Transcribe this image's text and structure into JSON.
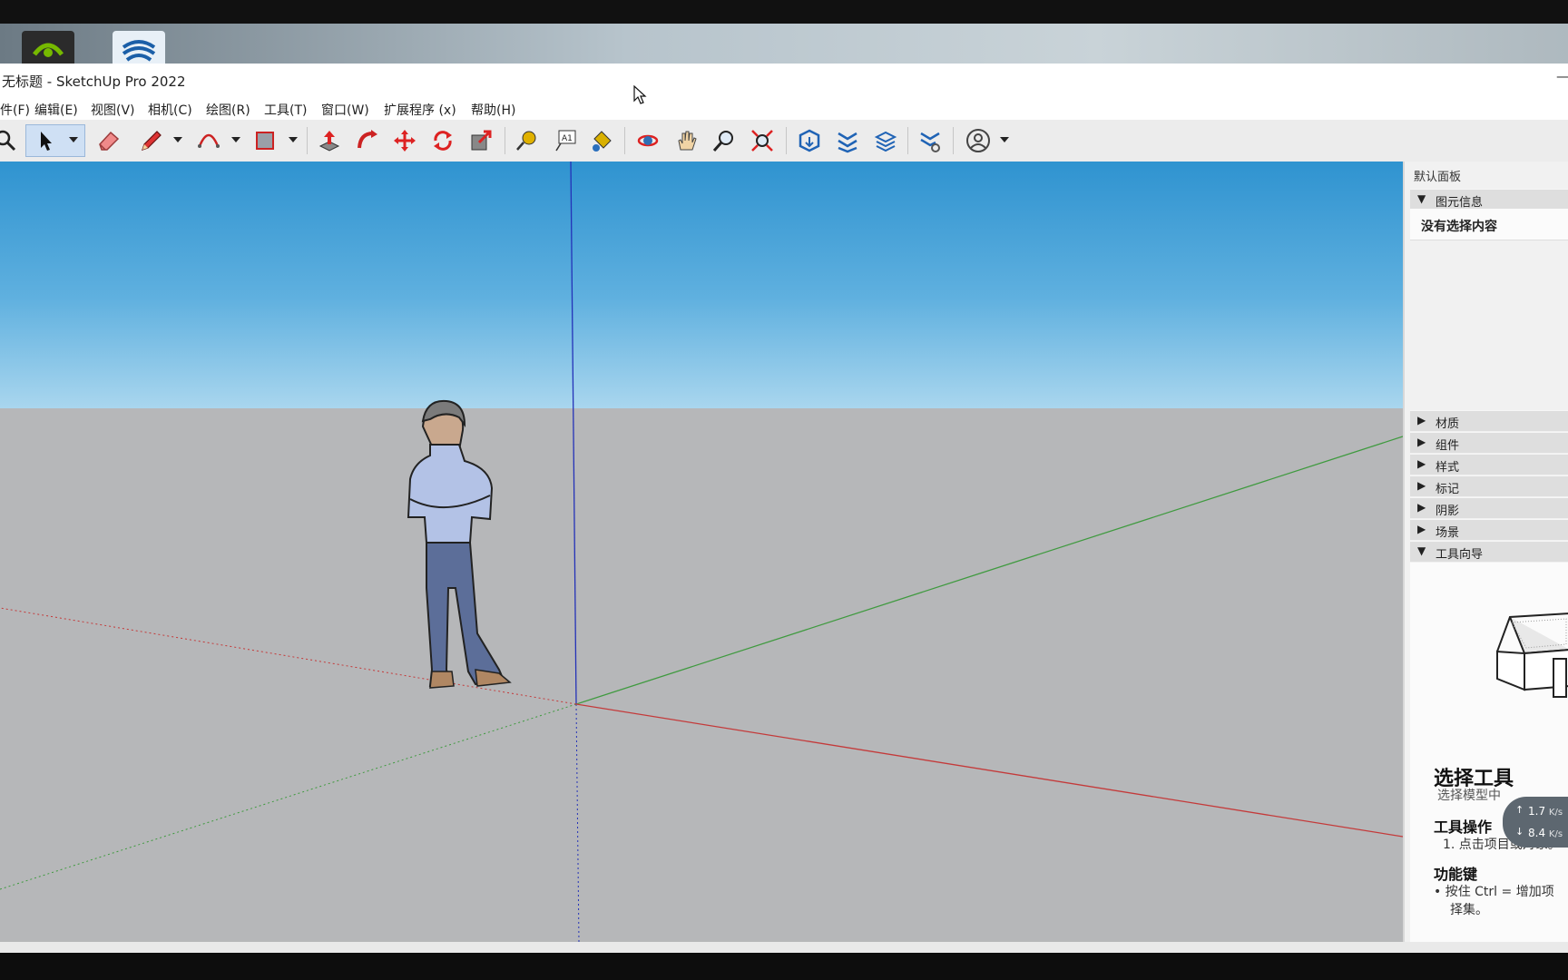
{
  "window": {
    "title": "无标题 - SketchUp Pro 2022",
    "minimize": "—"
  },
  "menu": [
    "件(F)",
    "编辑(E)",
    "视图(V)",
    "相机(C)",
    "绘图(R)",
    "工具(T)",
    "窗口(W)",
    "扩展程序 (x)",
    "帮助(H)"
  ],
  "toolbar": {
    "tools": [
      "zoom-icon",
      "select-arrow-icon",
      "eraser-icon",
      "pencil-icon",
      "arc-icon",
      "rectangle-icon",
      "push-pull-icon",
      "follow-me-icon",
      "move-icon",
      "rotate-icon",
      "scale-icon",
      "tape-measure-icon",
      "text-label-icon",
      "paint-bucket-icon",
      "orbit-icon",
      "pan-hand-icon",
      "zoom-magnifier-icon",
      "zoom-extents-icon",
      "3d-warehouse-icon",
      "extension-warehouse-icon",
      "layout-icon",
      "extension-manager-icon",
      "account-icon"
    ],
    "text_tool_glyph": "A1"
  },
  "tray": {
    "title": "默认面板",
    "entity_info": {
      "label": "图元信息",
      "empty": "没有选择内容"
    },
    "panels": [
      "材质",
      "组件",
      "样式",
      "标记",
      "阴影",
      "场景"
    ],
    "instructor": {
      "label": "工具向导",
      "tool_name": "选择工具",
      "subtitle": "选择模型中",
      "ops_title": "工具操作",
      "ops_step": "1. 点击项目或对象。",
      "keys_title": "功能键",
      "keys_line": "• 按住 Ctrl = 增加项",
      "keys_line2": "择集。"
    }
  },
  "net": {
    "up": "1.7",
    "down": "8.4",
    "unit": "K/s"
  },
  "colors": {
    "sky": "#2f93d0",
    "ground": "#b6b7b9",
    "axis_red": "#c43a3a",
    "axis_green": "#3f9a3f",
    "axis_blue": "#2432b8"
  }
}
